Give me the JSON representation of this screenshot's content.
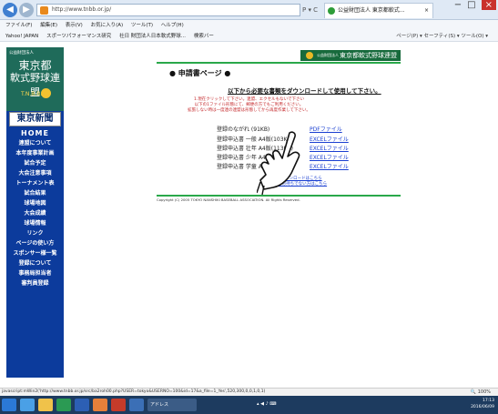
{
  "browser": {
    "address": "http://www.tnbb.or.jp/",
    "address_controls": "P ▾ C",
    "tab_title": "公益財団法人 東京都軟式...",
    "tab_close": "×",
    "window_controls": [
      "−",
      "□",
      "×"
    ]
  },
  "menu": [
    "ファイル(F)",
    "編集(E)",
    "表示(V)",
    "お気に入り(A)",
    "ツール(T)",
    "ヘルプ(H)"
  ],
  "favorites": [
    "Yahoo! JAPAN",
    "スポーツパフォーマンス研究",
    "社日 財団法人日本軟式野球...",
    "検索バー"
  ],
  "command_bar": "ページ(P) ▾  セーフティ(S) ▾  ツール(O) ▾",
  "sidebar": {
    "org_small": "公益財団法人",
    "title1": "東京都",
    "title2": "軟式野球連盟",
    "tnb": "T.N.B.B.",
    "newspaper": "東京新聞",
    "items": [
      "HOME",
      "連盟について",
      "本年度事業計画",
      "試合予定",
      "大会注意事項",
      "トーナメント表",
      "試合結果",
      "球場地図",
      "大会成績",
      "球場情報",
      "リンク",
      "ページの使い方",
      "スポンサー様一覧",
      "登録について",
      "事務局担当者",
      "審判員登録"
    ]
  },
  "header": {
    "org_small": "公益財団法人",
    "banner": "東京都軟式野球連盟"
  },
  "page": {
    "title": "● 申請書ページ ●",
    "subtitle": "以下から必要な書類をダウンロードして使用して下さい。",
    "notes": [
      "1.現在クリックして下さい。連盟、エクセルもないで下さい",
      "以下の1ファイル形態にて、郵便の方でもご利用ください。",
      "拡張しない時は一度連の連盟は形態してから再度作業して下さい。"
    ],
    "downloads": [
      {
        "name": "登録のながれ (91KB)",
        "link": "PDFファイル"
      },
      {
        "name": "登録申込書 一般 A4版(103KB)",
        "link": "EXCELファイル"
      },
      {
        "name": "登録申込書 壮年 A4版(113KB)",
        "link": "EXCELファイル"
      },
      {
        "name": "登録申込書 少年 A4版(1",
        "link": "EXCELファイル"
      },
      {
        "name": "登録申込書 学童 A4",
        "link": "EXCELファイル"
      }
    ],
    "office_links": [
      "Officeのダウンロードはこちら",
      "EXCELをお持ちでない方はこちら"
    ],
    "copyright": "Copyright (C) 2005 TOKYO NANSHIKI BASEBALL ASSOCIATION. All Rights Reserved."
  },
  "status": {
    "url": "javascript:mWin2('http://www.tnbb.or.jp/src/ba2roh00.php?USER=tokyo&USERNO=100&id=17&a_file=1_Yes',520,300,0,0,1,0,1)",
    "zoom": "100%"
  },
  "taskbar": {
    "search": "アドレス",
    "time": "17:13",
    "date": "2016/06/09"
  }
}
